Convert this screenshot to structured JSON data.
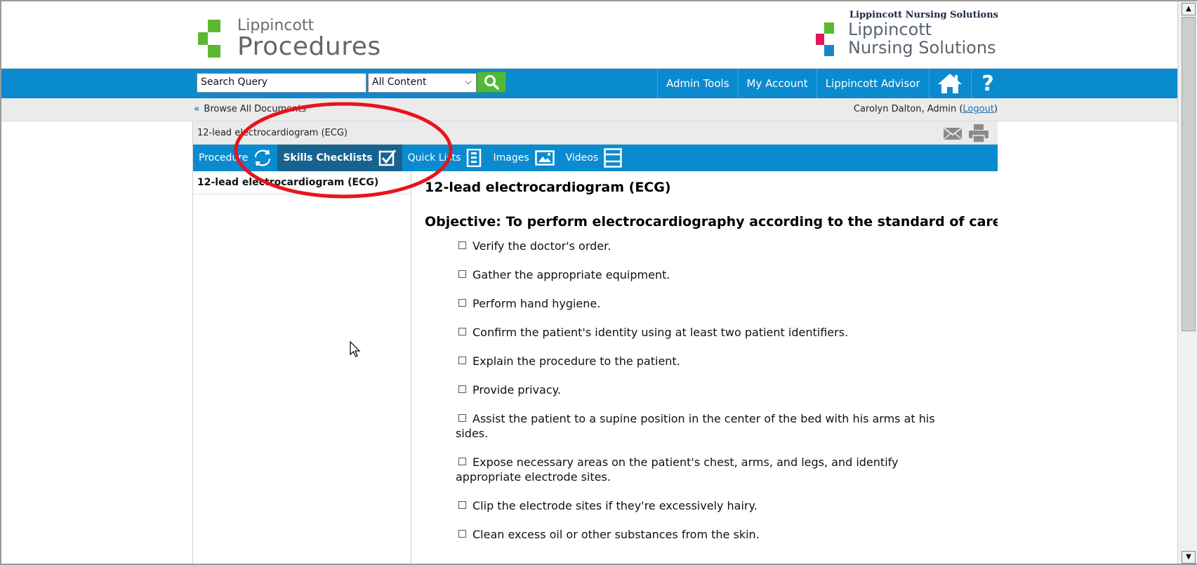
{
  "header": {
    "logo_left_line1": "Lippincott",
    "logo_left_line2": "Procedures",
    "logo_right_super": "Lippincott Nursing Solutions",
    "logo_right_line1": "Lippincott",
    "logo_right_line2": "Nursing Solutions"
  },
  "nav": {
    "search_value": "Search Query",
    "scope_selected": "All Content",
    "links": [
      "Admin Tools",
      "My Account",
      "Lippincott Advisor"
    ],
    "help_glyph": "?"
  },
  "greybar": {
    "browse_label": "Browse All Documents",
    "user_label": "Carolyn Dalton, Admin (",
    "logout_label": "Logout",
    "user_suffix": ")"
  },
  "document": {
    "title_bar": "12-lead electrocardiogram (ECG)",
    "tabs": [
      "Procedure",
      "Skills Checklists",
      "Quick Lists",
      "Images",
      "Videos"
    ],
    "active_tab": "Skills Checklists",
    "left_item": "12-lead electrocardiogram (ECG)",
    "heading": "12-lead electrocardiogram (ECG)",
    "objective": "Objective: To perform electrocardiography according to the standard of care.",
    "steps": [
      "Verify the doctor's order.",
      "Gather the appropriate equipment.",
      "Perform hand hygiene.",
      "Confirm the patient's identity using at least two patient identifiers.",
      "Explain the procedure to the patient.",
      "Provide privacy.",
      "Assist the patient to a supine position in the center of the bed with his arms at his sides.",
      "Expose necessary areas on the patient's chest, arms, and legs, and identify appropriate electrode sites.",
      "Clip the electrode sites if they're excessively hairy.",
      "Clean excess oil or other substances from the skin."
    ]
  },
  "colors": {
    "nav_blue": "#0b8bcf",
    "active_tab": "#17628f",
    "search_green": "#52b83b",
    "annotation_red": "#e8141b"
  }
}
